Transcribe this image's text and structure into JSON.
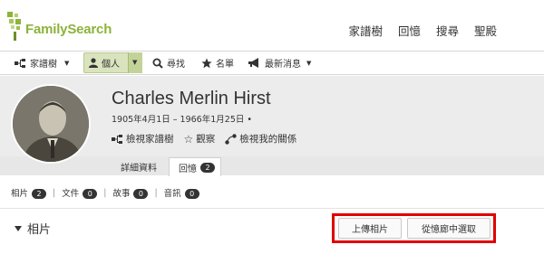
{
  "brand": {
    "logo_text": "FamilySearch",
    "color": "#8cb33a"
  },
  "top_nav": [
    "家譜樹",
    "回憶",
    "搜尋",
    "聖殿"
  ],
  "menu": {
    "tree": "家譜樹",
    "person": "個人",
    "search": "尋找",
    "list": "名單",
    "news": "最新消息"
  },
  "profile": {
    "name": "Charles Merlin Hirst",
    "dates": "1905年4月1日 – 1966年1月25日 •",
    "actions": {
      "view_tree": "檢視家譜樹",
      "watch": "觀察",
      "relationship": "檢視我的關係"
    }
  },
  "tabs": {
    "details": "詳細資料",
    "memories": "回憶",
    "memories_count": "2"
  },
  "filters": [
    {
      "label": "相片",
      "count": "2"
    },
    {
      "label": "文件",
      "count": "0"
    },
    {
      "label": "故事",
      "count": "0"
    },
    {
      "label": "音訊",
      "count": "0"
    }
  ],
  "photos_section": {
    "title": "相片",
    "upload_button": "上傳相片",
    "gallery_button": "從憶廊中選取"
  },
  "highlight_color": "#e00000"
}
